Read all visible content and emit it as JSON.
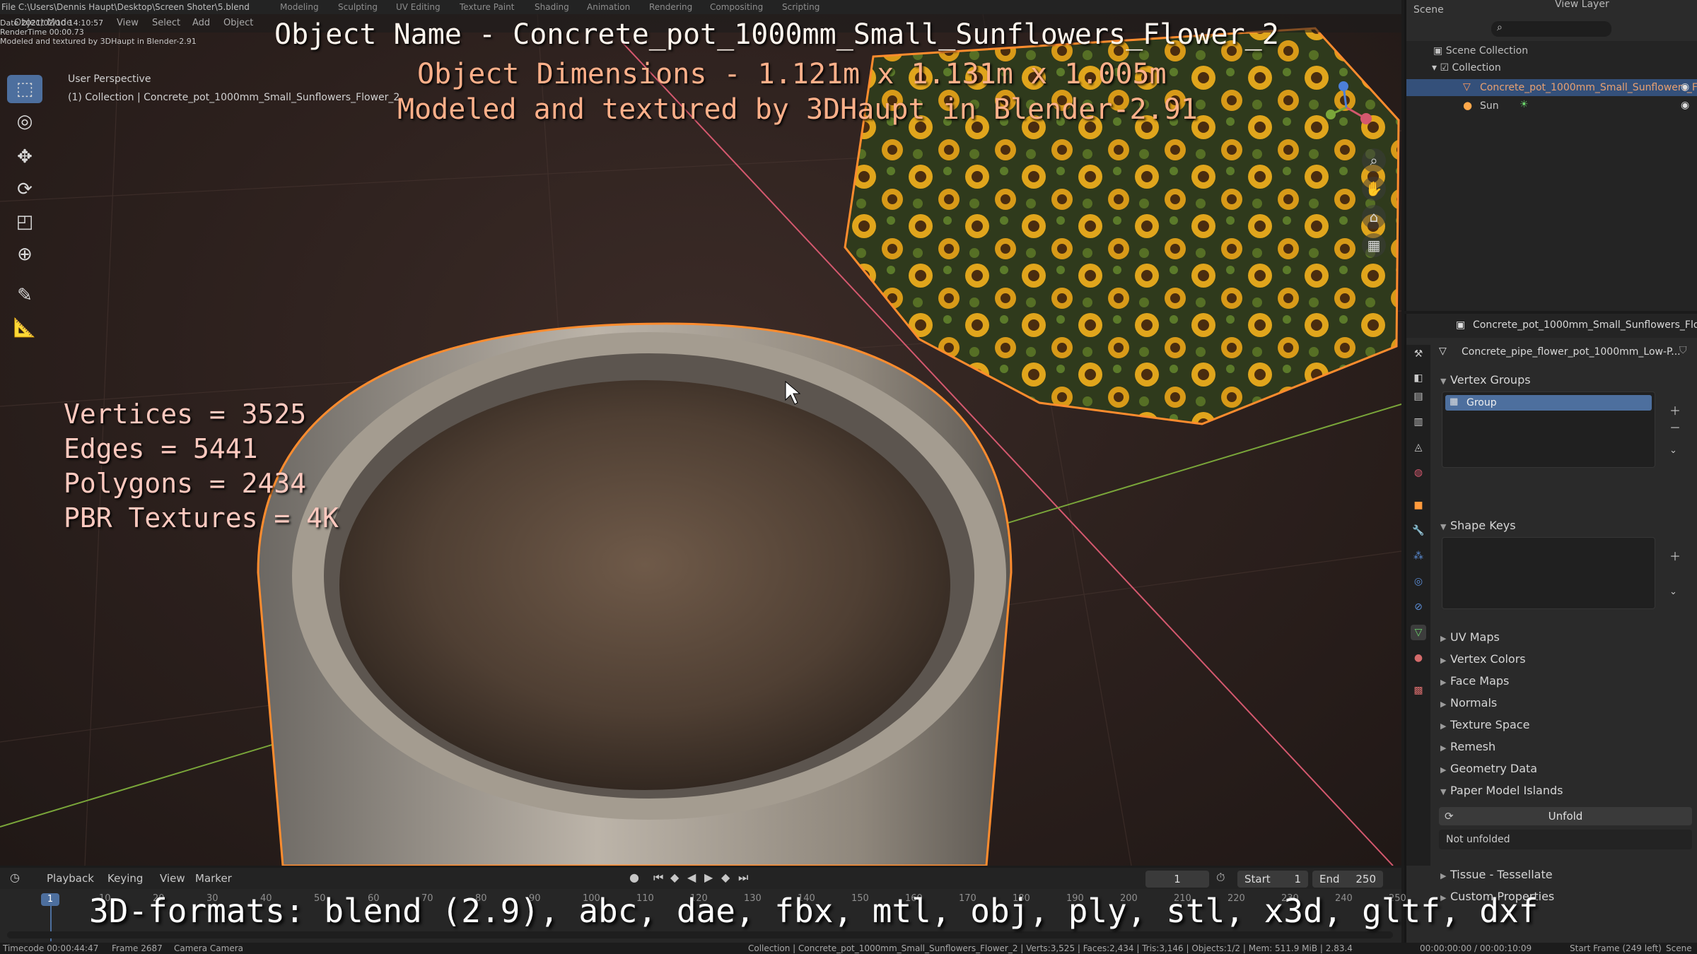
{
  "titlebar": {
    "file_path": "File  C:\\Users\\Dennis Haupt\\Desktop\\Screen Shoter\\5.blend",
    "date_line": "Date 2021/02/10 14:10:57",
    "render_time": "RenderTime 00:00.73",
    "credit_small": "Modeled and textured by 3DHaupt in Blender-2.91",
    "workspaces": [
      "Modeling",
      "Sculpting",
      "UV Editing",
      "Texture Paint",
      "Shading",
      "Animation",
      "Rendering",
      "Compositing",
      "Scripting"
    ],
    "scene_label": "Scene",
    "view_layer_label": "View Layer"
  },
  "viewport": {
    "mode": "Object Mode",
    "menus": [
      "View",
      "Select",
      "Add",
      "Object"
    ],
    "view_name": "User Perspective",
    "view_collection": "(1) Collection | Concrete_pot_1000mm_Small_Sunflowers_Flower_2"
  },
  "overlay": {
    "object_name": "Object Name - Concrete_pot_1000mm_Small_Sunflowers_Flower_2",
    "dimensions": "Object Dimensions -  1.121m x 1.131m x 1.005m",
    "credit": "Modeled and textured by 3DHaupt in Blender-2.91",
    "stats": [
      "Vertices = 3525",
      "Edges = 5441",
      "Polygons = 2434",
      "PBR Textures = 4K"
    ],
    "formats": "3D-formats: blend (2.9), abc, dae, fbx, mtl, obj, ply, stl, x3d, gltf, dxf"
  },
  "outliner": {
    "root": "Scene Collection",
    "collection": "Collection",
    "items": [
      {
        "label": "Concrete_pot_1000mm_Small_Sunflowers_F"
      },
      {
        "label": "Sun"
      }
    ]
  },
  "properties": {
    "object_label": "Concrete_pot_1000mm_Small_Sunflowers_Flower",
    "mesh_label": "Concrete_pipe_flower_pot_1000mm_Low-P...",
    "vertex_groups_title": "Vertex Groups",
    "vertex_group_item": "Group",
    "shape_keys_title": "Shape Keys",
    "collapsed_panels": [
      "UV Maps",
      "Vertex Colors",
      "Face Maps",
      "Normals",
      "Texture Space",
      "Remesh",
      "Geometry Data"
    ],
    "paper_model_title": "Paper Model Islands",
    "unfold_button": "Unfold",
    "not_unfolded": "Not unfolded",
    "more_panels": [
      "Tissue - Tessellate",
      "Custom Properties"
    ]
  },
  "timeline": {
    "menus": [
      "Playback",
      "Keying",
      "View",
      "Marker"
    ],
    "current_frame": "1",
    "start_label": "Start",
    "start_value": "1",
    "end_label": "End",
    "end_value": "250",
    "ruler_ticks": [
      "0",
      "10",
      "20",
      "30",
      "40",
      "50",
      "60",
      "70",
      "80",
      "90",
      "100",
      "110",
      "120",
      "130",
      "140",
      "150",
      "160",
      "170",
      "180",
      "190",
      "200",
      "210",
      "220",
      "230",
      "240",
      "250"
    ],
    "playhead_frame": "1"
  },
  "statusbar": {
    "timecode": "Timecode 00:00:44:47",
    "frame": "Frame 2687",
    "camera": "Camera Camera",
    "scene_stats": "Collection | Concrete_pot_1000mm_Small_Sunflowers_Flower_2 | Verts:3,525 | Faces:2,434 | Tris:3,146 | Objects:1/2 | Mem: 511.9 MiB | 2.83.4",
    "time_range": "00:00:00:00 / 00:00:10:09",
    "start_frame": "Start Frame (249 left)",
    "scene_name": "Scene"
  },
  "colors": {
    "accent_blue": "#4d6f9e",
    "selection_orange": "#ff8c2e",
    "axis_red": "#d4586e",
    "axis_green": "#7aa63a"
  }
}
